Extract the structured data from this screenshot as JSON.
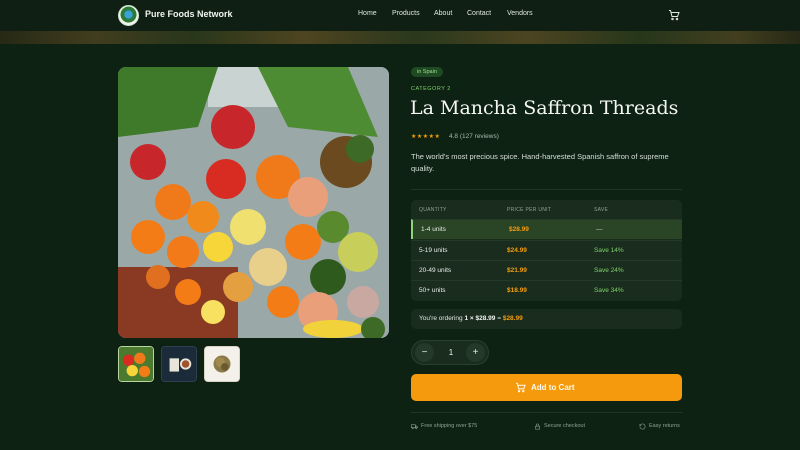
{
  "header": {
    "brand": "Pure Foods Network",
    "nav": [
      {
        "label": "Home"
      },
      {
        "label": "Products"
      },
      {
        "label": "About"
      },
      {
        "label": "Contact"
      },
      {
        "label": "Vendors"
      }
    ],
    "cart_icon": "shopping-cart-icon"
  },
  "gallery": {
    "main_image": "fresh-produce-photo",
    "thumbnails": [
      "fresh-produce-thumbnail",
      "tea-cup-thumbnail",
      "saffron-threads-thumbnail"
    ]
  },
  "product": {
    "origin_badge": "in Spain",
    "category": "CATEGORY 2",
    "title": "La Mancha Saffron Threads",
    "stars": "★★★★★",
    "rating_text": "4.8 (127 reviews)",
    "description": "The world's most precious spice. Hand-harvested Spanish saffron of supreme quality."
  },
  "pricing": {
    "headers": {
      "quantity": "QUANTITY",
      "price": "PRICE PER UNIT",
      "save": "SAVE"
    },
    "rows": [
      {
        "quantity": "1-4 units",
        "price": "$28.99",
        "save": "—"
      },
      {
        "quantity": "5-19 units",
        "price": "$24.99",
        "save": "Save 14%"
      },
      {
        "quantity": "20-49 units",
        "price": "$21.99",
        "save": "Save 24%"
      },
      {
        "quantity": "50+ units",
        "price": "$18.99",
        "save": "Save 34%"
      }
    ],
    "active_row": 0
  },
  "order": {
    "prefix": "You're ordering",
    "count": "1",
    "times": "×",
    "unit_price": "$28.99",
    "equals": "=",
    "total": "$28.99"
  },
  "quantity": {
    "value": "1",
    "minus": "−",
    "plus": "+"
  },
  "cart": {
    "label": "Add to Cart"
  },
  "features": [
    {
      "label": "Free shipping over $75",
      "icon": "truck-icon"
    },
    {
      "label": "Secure checkout",
      "icon": "lock-icon"
    },
    {
      "label": "Easy returns",
      "icon": "return-icon"
    }
  ],
  "colors": {
    "accent": "#f59a0c",
    "background": "#0e2213",
    "highlight": "#7fd36b"
  }
}
